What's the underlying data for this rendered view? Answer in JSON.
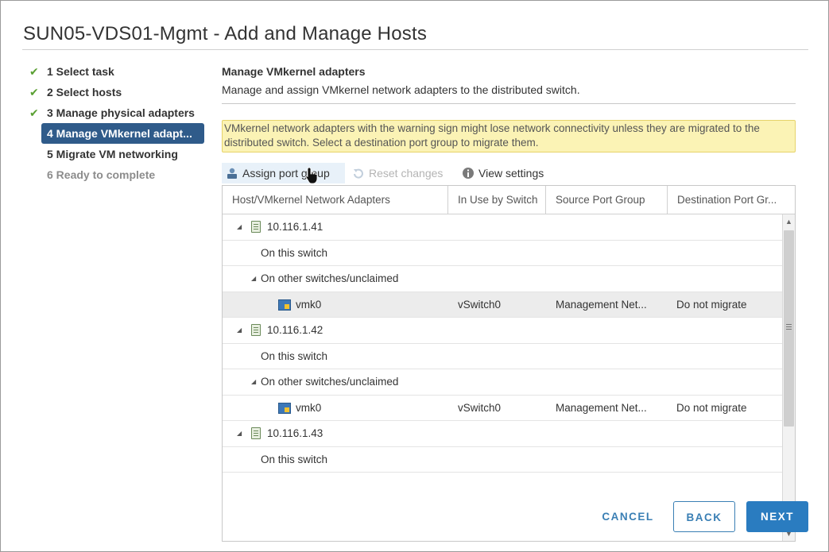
{
  "dialog": {
    "title": "SUN05-VDS01-Mgmt - Add and Manage Hosts"
  },
  "steps": [
    {
      "label": "1 Select task",
      "state": "done"
    },
    {
      "label": "2 Select hosts",
      "state": "done"
    },
    {
      "label": "3 Manage physical adapters",
      "state": "done"
    },
    {
      "label": "4 Manage VMkernel adapt...",
      "state": "active"
    },
    {
      "label": "5 Migrate VM networking",
      "state": "pending"
    },
    {
      "label": "6 Ready to complete",
      "state": "disabled"
    }
  ],
  "main": {
    "title": "Manage VMkernel adapters",
    "description": "Manage and assign VMkernel network adapters to the distributed switch.",
    "warning": "VMkernel network adapters with the warning sign might lose network connectivity unless they are migrated to the distributed switch. Select a destination port group to migrate them."
  },
  "toolbar": {
    "assign": "Assign port group",
    "reset": "Reset changes",
    "view": "View settings"
  },
  "grid": {
    "columns": [
      "Host/VMkernel Network Adapters",
      "In Use by Switch",
      "Source Port Group",
      "Destination Port Gr..."
    ],
    "rows": [
      {
        "type": "host",
        "label": "10.116.1.41"
      },
      {
        "type": "group",
        "label": "On this switch"
      },
      {
        "type": "subgroup",
        "label": "On other switches/unclaimed"
      },
      {
        "type": "adapter",
        "label": "vmk0",
        "switch": "vSwitch0",
        "source": "Management Net...",
        "dest": "Do not migrate",
        "selected": true
      },
      {
        "type": "host",
        "label": "10.116.1.42"
      },
      {
        "type": "group",
        "label": "On this switch"
      },
      {
        "type": "subgroup",
        "label": "On other switches/unclaimed"
      },
      {
        "type": "adapter",
        "label": "vmk0",
        "switch": "vSwitch0",
        "source": "Management Net...",
        "dest": "Do not migrate",
        "selected": false
      },
      {
        "type": "host",
        "label": "10.116.1.43"
      },
      {
        "type": "group",
        "label": "On this switch"
      }
    ]
  },
  "footer": {
    "cancel": "CANCEL",
    "back": "BACK",
    "next": "NEXT"
  },
  "colors": {
    "accent": "#2a7cc0",
    "active_step": "#2f5b8a",
    "check": "#5aa033",
    "warning_bg": "#fbf3b5"
  },
  "icons": {
    "step_done": "checkmark-icon",
    "assign": "assign-port-group-icon",
    "reset": "reset-icon",
    "view": "info-icon",
    "host": "host-server-icon",
    "adapter": "vmkernel-adapter-icon"
  }
}
